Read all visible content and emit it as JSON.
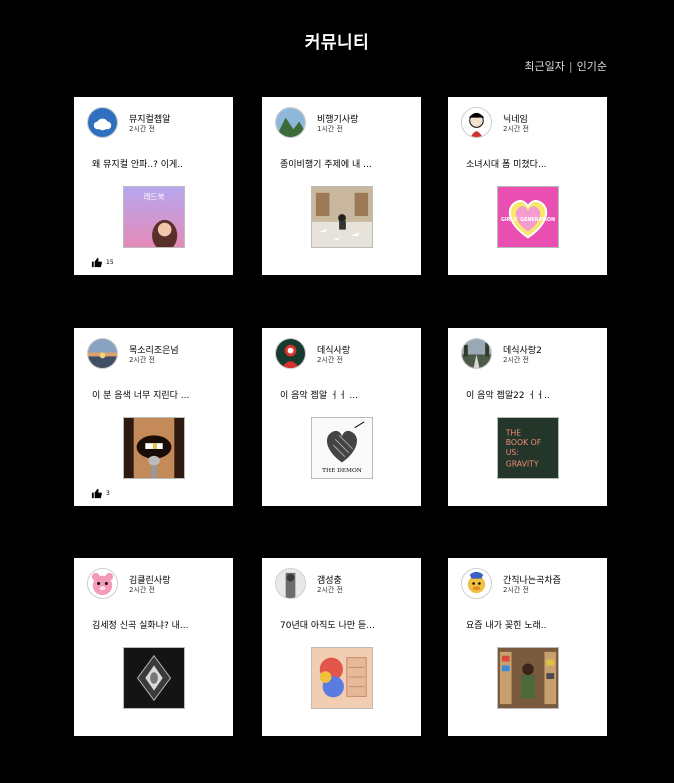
{
  "page": {
    "title": "커뮤니티",
    "sort_recent": "최근일자",
    "sort_divider": "|",
    "sort_popular": "인기순"
  },
  "posts": [
    {
      "user": "뮤지컬젭알",
      "time": "2시간 전",
      "text": "왜 뮤지컬 안파..? 이게..",
      "likes": "15",
      "avatar_icon": "sky-avatar-icon",
      "thumb_icon": "musical-poster-thumbnail",
      "thumb_text": "레드북"
    },
    {
      "user": "비행기사랑",
      "time": "1시간 전",
      "text": "종이비행기 주제에 내 ...",
      "likes": "",
      "avatar_icon": "mountain-avatar-icon",
      "thumb_icon": "paper-plane-room-thumbnail",
      "thumb_text": ""
    },
    {
      "user": "닉네임",
      "time": "2시간 전",
      "text": "소녀시대 폼 미쳤다...",
      "likes": "",
      "avatar_icon": "cartoon-avatar-icon",
      "thumb_icon": "heart-album-thumbnail",
      "thumb_text": "GIRLS' GENERATION"
    },
    {
      "user": "목소리조은넘",
      "time": "2시간 전",
      "text": "이 분 음색 너무 지린다 ...",
      "likes": "3",
      "avatar_icon": "sunset-avatar-icon",
      "thumb_icon": "singer-face-thumbnail",
      "thumb_text": ""
    },
    {
      "user": "데식사랑",
      "time": "2시간 전",
      "text": "이 음악 젭알 ㅓㅓ ...",
      "likes": "",
      "avatar_icon": "red-figure-avatar-icon",
      "thumb_icon": "heart-sketch-album-thumbnail",
      "thumb_text": "THE DEMON"
    },
    {
      "user": "데식사랑2",
      "time": "2시간 전",
      "text": "이 음악 젭알22 ㅓㅓ..",
      "likes": "",
      "avatar_icon": "road-avatar-icon",
      "thumb_icon": "book-of-us-album-thumbnail",
      "thumb_text": "THE BOOK OF US: GRAVITY"
    },
    {
      "user": "김클린사랑",
      "time": "2시간 전",
      "text": "김세정 신곡 실화냐? 내...",
      "likes": "",
      "avatar_icon": "pink-plush-avatar-icon",
      "thumb_icon": "dark-diamond-album-thumbnail",
      "thumb_text": ""
    },
    {
      "user": "갬성충",
      "time": "2시간 전",
      "text": "70년대 아직도 나만 듣...",
      "likes": "",
      "avatar_icon": "bw-figure-avatar-icon",
      "thumb_icon": "retro-album-thumbnail",
      "thumb_text": ""
    },
    {
      "user": "간직나는곡차즘",
      "time": "2시간 전",
      "text": "요즘 내가 꽂힌 노래..",
      "likes": "",
      "avatar_icon": "duck-avatar-icon",
      "thumb_icon": "record-shop-thumbnail",
      "thumb_text": ""
    }
  ],
  "colors": {
    "background": "#000000",
    "card": "#ffffff",
    "accent_pink": "#e84fb0"
  }
}
